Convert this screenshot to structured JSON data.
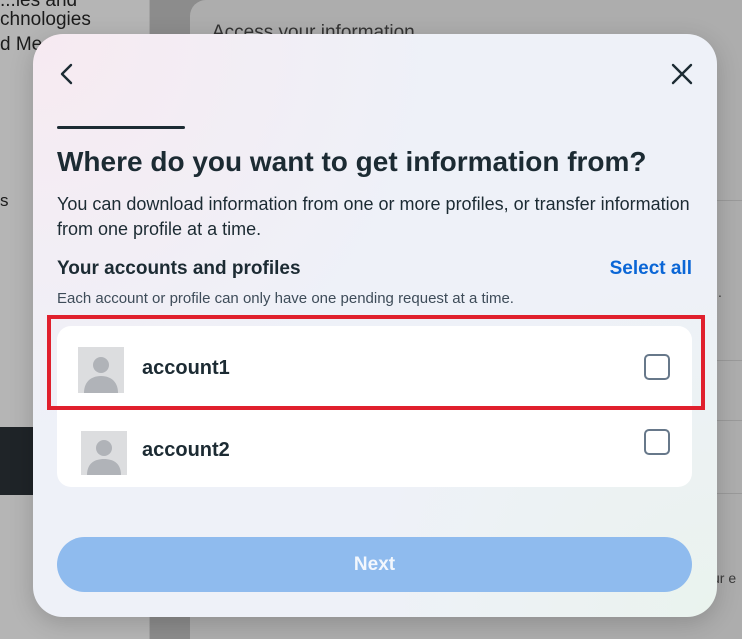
{
  "background": {
    "left_text": [
      "...ies and",
      "chnologies",
      "d Me..."
    ],
    "left_side_letter": "s",
    "right_title": "Access your information",
    "right_fragments": [
      ".",
      "ur e"
    ]
  },
  "modal": {
    "back_icon": "chevron-left-icon",
    "close_icon": "close-icon",
    "title": "Where do you want to get information from?",
    "description": "You can download information from one or more profiles, or transfer information from one profile at a time.",
    "section_title": "Your accounts and profiles",
    "select_all_label": "Select all",
    "note": "Each account or profile can only have one pending request at a time.",
    "accounts": [
      {
        "name": "account1",
        "checked": false
      },
      {
        "name": "account2",
        "checked": false
      }
    ],
    "next_label": "Next"
  },
  "colors": {
    "accent": "#0a66d6",
    "next_disabled": "#8fbbee",
    "highlight": "#e0202d",
    "text": "#1c2b33"
  }
}
